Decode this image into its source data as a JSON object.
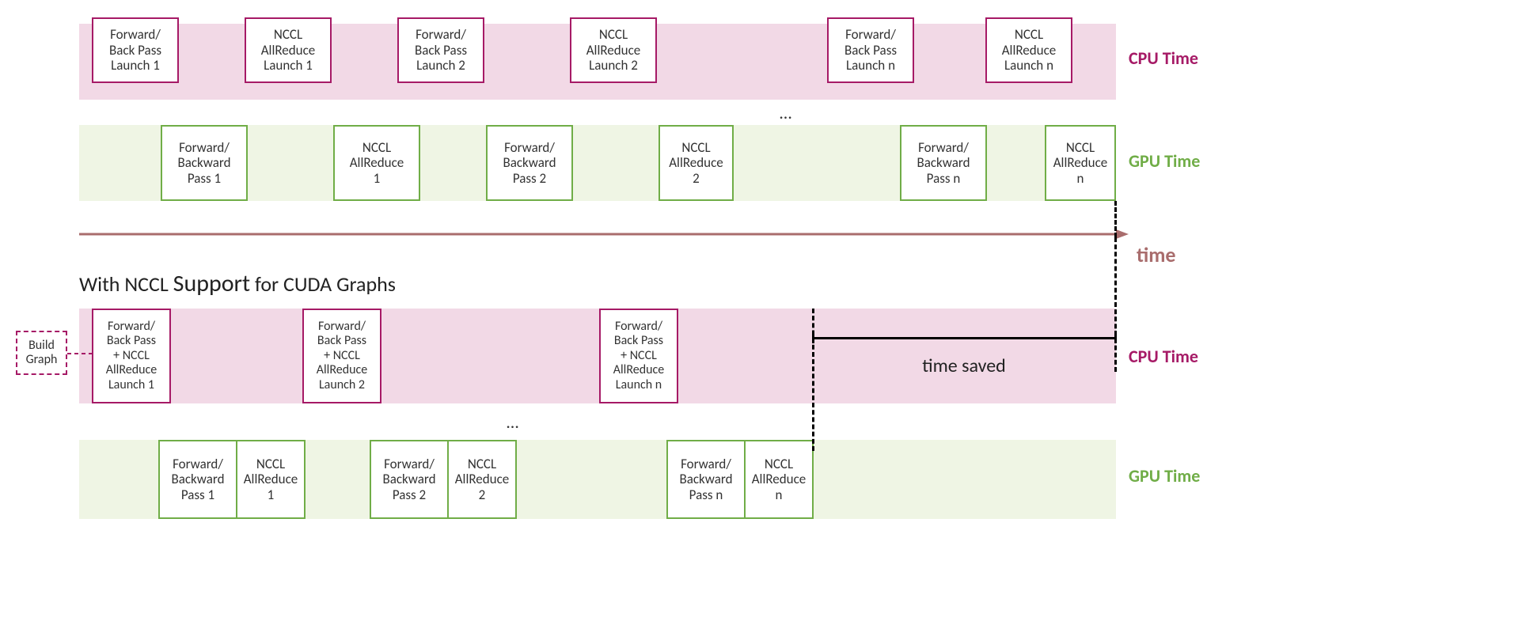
{
  "labels": {
    "cpu_time": "CPU Time",
    "gpu_time": "GPU Time",
    "time": "time",
    "time_saved": "time saved",
    "ellipsis": "…",
    "section_title": "With NCCL Support for CUDA Graphs",
    "build_graph": "Build\nGraph"
  },
  "top": {
    "cpu_boxes": [
      "Forward/\nBack Pass\nLaunch 1",
      "NCCL\nAllReduce\nLaunch 1",
      "Forward/\nBack Pass\nLaunch 2",
      "NCCL\nAllReduce\nLaunch 2",
      "Forward/\nBack Pass\nLaunch n",
      "NCCL\nAllReduce\nLaunch n"
    ],
    "gpu_boxes": [
      "Forward/\nBackward\nPass 1",
      "NCCL\nAllReduce\n1",
      "Forward/\nBackward\nPass 2",
      "NCCL\nAllReduce\n2",
      "Forward/\nBackward\nPass n",
      "NCCL\nAllReduce\nn"
    ]
  },
  "bottom": {
    "cpu_boxes": [
      "Forward/\nBack Pass\n+ NCCL\nAllReduce\nLaunch 1",
      "Forward/\nBack Pass\n+ NCCL\nAllReduce\nLaunch 2",
      "Forward/\nBack Pass\n+ NCCL\nAllReduce\nLaunch n"
    ],
    "gpu_boxes": [
      "Forward/\nBackward\nPass 1",
      "NCCL\nAllReduce\n1",
      "Forward/\nBackward\nPass 2",
      "NCCL\nAllReduce\n2",
      "Forward/\nBackward\nPass n",
      "NCCL\nAllReduce\nn"
    ]
  },
  "colors": {
    "cpu_fill": "#f2d9e6",
    "cpu_border": "#a61a66",
    "gpu_fill": "#eff5e4",
    "gpu_border": "#70ad47",
    "time_axis": "#a96d6d"
  }
}
